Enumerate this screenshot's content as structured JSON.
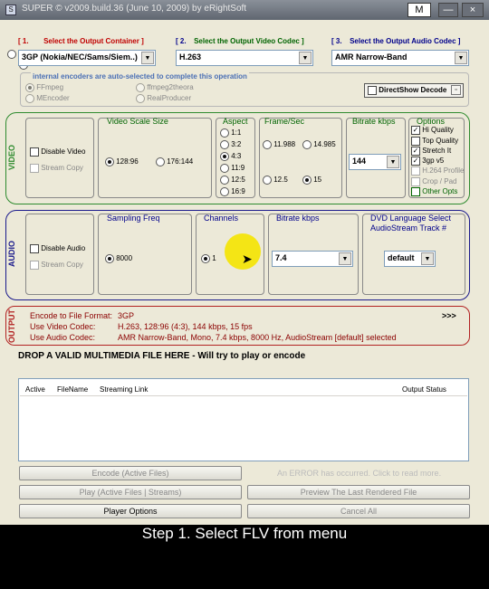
{
  "title": "SUPER © v2009.build.36 (June 10, 2009) by eRightSoft",
  "titlebar_buttons": {
    "m": "M",
    "minimize": "—",
    "close": "×"
  },
  "step1": {
    "num": "[ 1.",
    "text": "Select the Output Container ]",
    "value": "3GP (Nokia/NEC/Sams/Siem..)"
  },
  "step2": {
    "num": "[ 2.",
    "text": "Select the Output Video Codec ]",
    "value": "H.263"
  },
  "step3": {
    "num": "[ 3.",
    "text": "Select the Output Audio Codec ]",
    "value": "AMR Narrow-Band"
  },
  "encoders": {
    "heading": "internal encoders are auto-selected to complete this operation",
    "ffmpeg": "FFmpeg",
    "mencoder": "MEncoder",
    "ffmpeg2theora": "ffmpeg2theora",
    "realproducer": "RealProducer",
    "directshow": "DirectShow Decode"
  },
  "video": {
    "section": "VIDEO",
    "disable": "Disable Video",
    "streamcopy": "Stream Copy",
    "scale_label": "Video Scale Size",
    "scale_opts": [
      "128:96",
      "176:144"
    ],
    "aspect_label": "Aspect",
    "aspect_opts": [
      "1:1",
      "3:2",
      "4:3",
      "11:9",
      "12:5",
      "16:9"
    ],
    "fps_label": "Frame/Sec",
    "fps_opts": [
      "11.988",
      "14.985",
      "12.5",
      "15"
    ],
    "bitrate_label": "Bitrate  kbps",
    "bitrate_value": "144",
    "options_label": "Options",
    "options": [
      "Hi Quality",
      "Top Quality",
      "Stretch It",
      "3gp v5",
      "H.264 Profile",
      "Crop / Pad",
      "Other Opts"
    ]
  },
  "audio": {
    "section": "AUDIO",
    "disable": "Disable Audio",
    "streamcopy": "Stream Copy",
    "freq_label": "Sampling Freq",
    "freq_value": "8000",
    "channels_label": "Channels",
    "channels_value": "1",
    "bitrate_label": "Bitrate  kbps",
    "bitrate_value": "7.4",
    "dvd_label": "DVD Language Select",
    "dvd_sub": "AudioStream  Track #",
    "dvd_value": "default"
  },
  "output": {
    "section": "OUTPUT",
    "l1": "Encode to File Format:",
    "v1": "3GP",
    "l2": "Use Video Codec:",
    "v2": "H.263,  128:96 (4:3),  144 kbps,  15 fps",
    "l3": "Use Audio Codec:",
    "v3": "AMR Narrow-Band,  Mono,  7.4 kbps,  8000 Hz,  AudioStream [default] selected",
    "more": ">>>"
  },
  "drop": "DROP A VALID MULTIMEDIA FILE HERE - Will try to play or encode",
  "filelist": {
    "cols": [
      "Active",
      "FileName",
      "Streaming Link",
      "Output Status"
    ]
  },
  "buttons": {
    "encode": "Encode (Active Files)",
    "error": "An ERROR has occurred. Click to read more.",
    "play": "Play (Active Files | Streams)",
    "preview": "Preview The Last Rendered File",
    "player": "Player Options",
    "cancel": "Cancel All"
  },
  "caption": "Step 1. Select FLV from menu",
  "colors": {
    "video_border": "#2e8b2e",
    "audio_border": "#1a1a8c",
    "output_border": "#b22222",
    "highlight": "#f5e400"
  }
}
